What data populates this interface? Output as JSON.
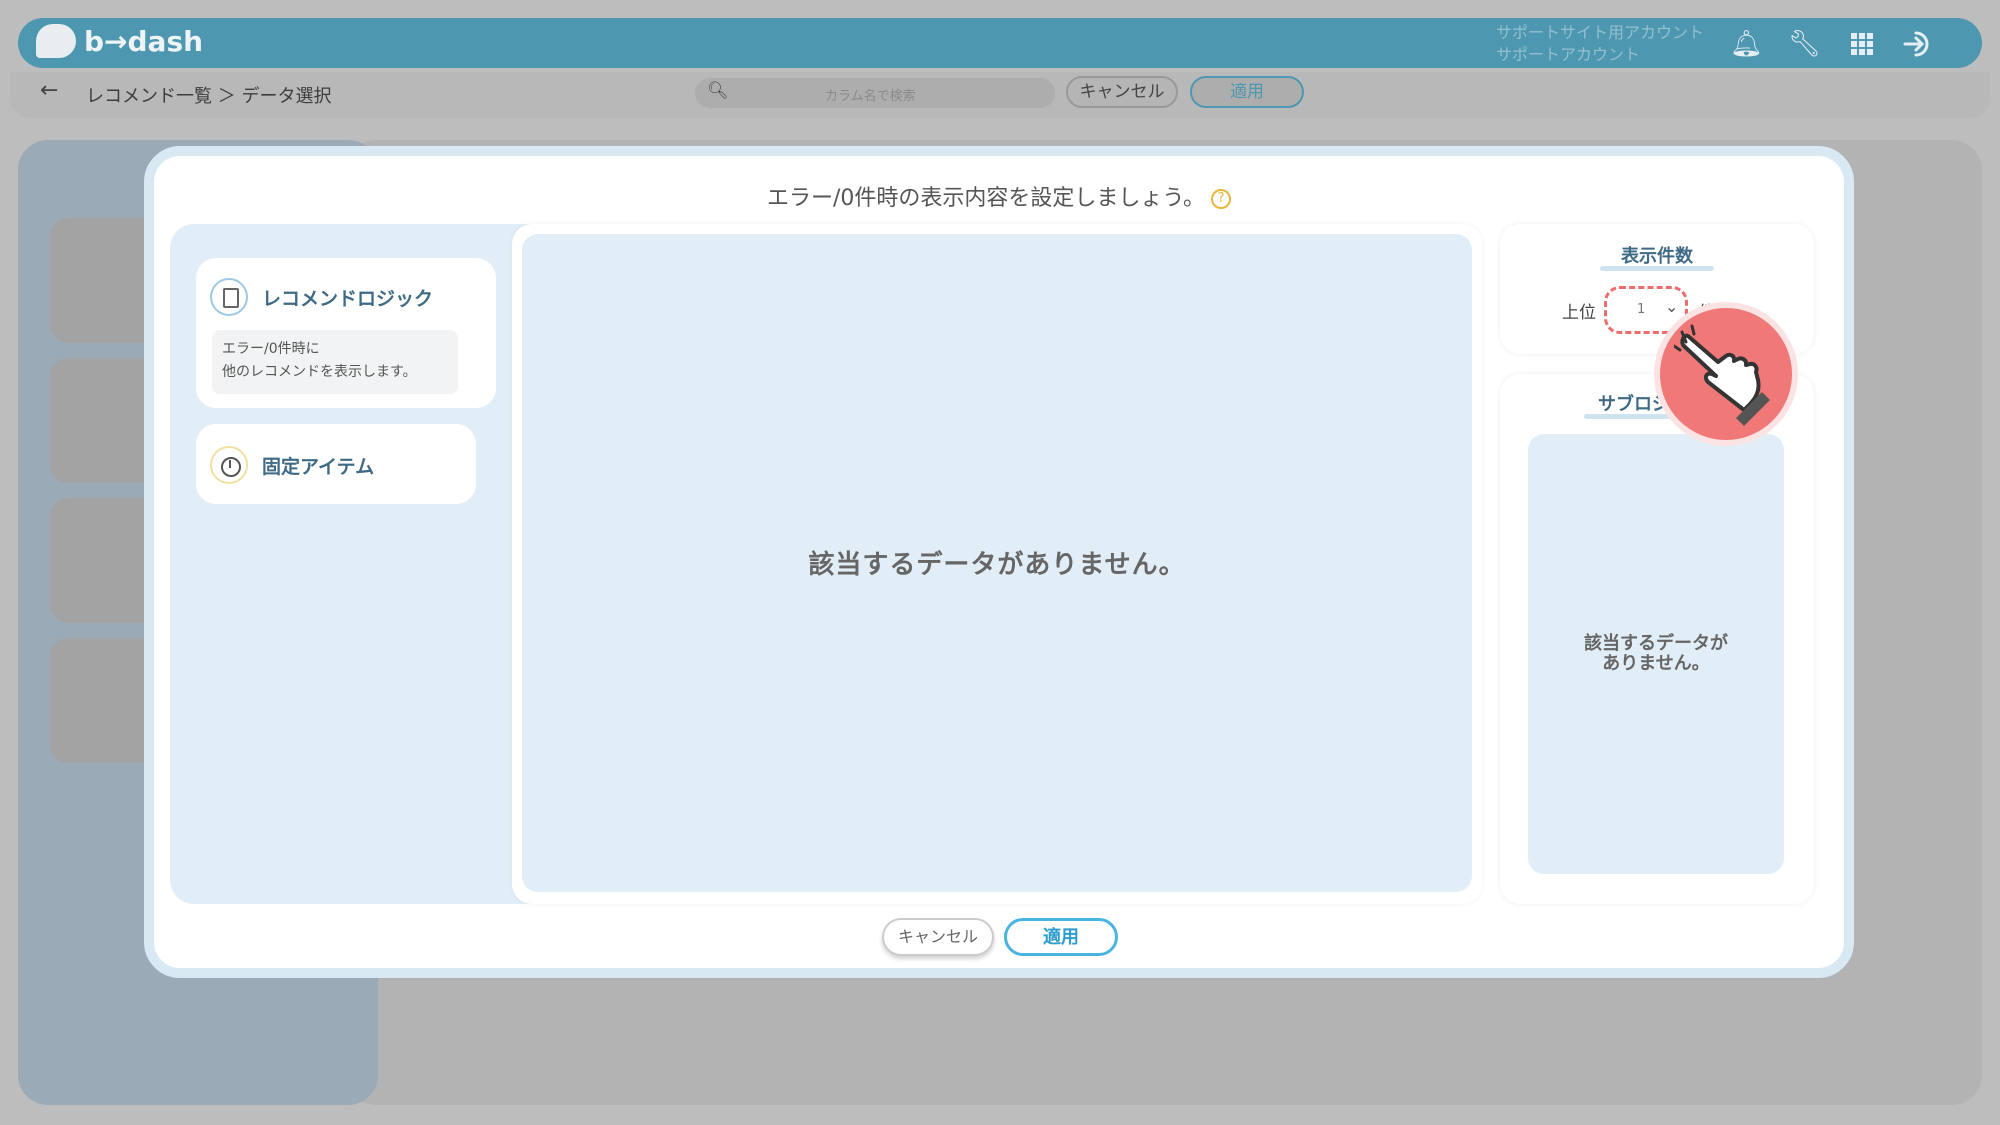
{
  "app": {
    "logo_text": "b→dash",
    "account_line1": "サポートサイト用アカウント",
    "account_line2": "サポートアカウント"
  },
  "header_icons": [
    "bell-icon",
    "wrench-icon",
    "grid-icon",
    "logout-icon"
  ],
  "breadcrumb": "レコメンド一覧 ＞ データ選択",
  "toolbar": {
    "search_placeholder": "カラム名で検索",
    "cancel_label": "キャンセル",
    "apply_label": "適用"
  },
  "modal": {
    "title": "エラー/0件時の表示内容を設定しましょう。",
    "help_glyph": "?",
    "logic_card": {
      "title": "レコメンドロジック",
      "desc_line1": "エラー/0件時に",
      "desc_line2": "他のレコメンドを表示します。"
    },
    "fixed_card": {
      "title": "固定アイテム"
    },
    "preview_empty": "該当するデータがありません。",
    "count": {
      "title": "表示件数",
      "prefix": "上位",
      "value": "1",
      "suffix": "件まで"
    },
    "sub": {
      "title": "サブロジック",
      "empty_line1": "該当するデータが",
      "empty_line2": "ありません。"
    },
    "cancel_label": "キャンセル",
    "apply_label": "適用"
  },
  "colors": {
    "brand": "#4d97b0",
    "accent": "#48b4e0",
    "highlight": "#ee6b6b",
    "panel": "#e2eef7"
  }
}
